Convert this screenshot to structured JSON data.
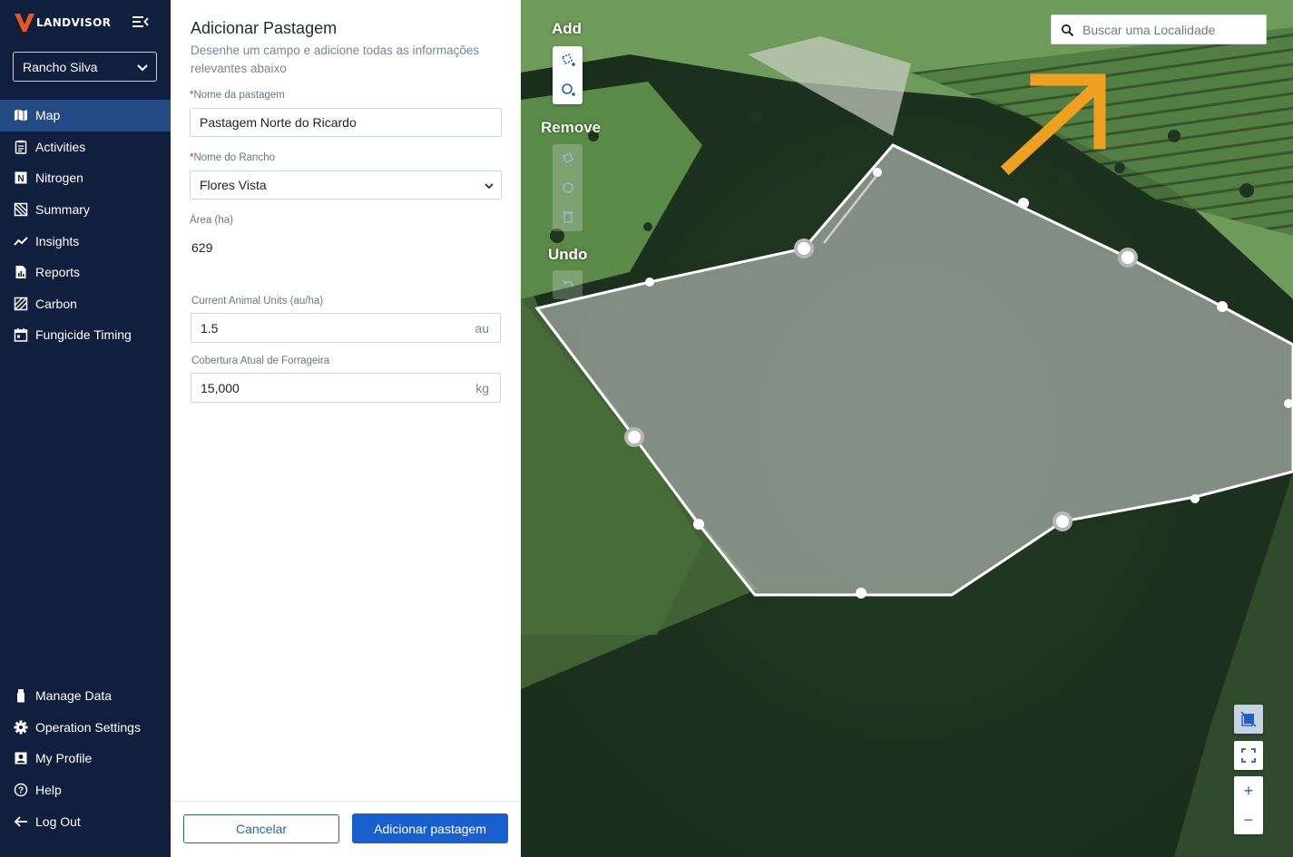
{
  "brand": {
    "name": "LANDVISOR"
  },
  "ranch_selector": {
    "value": "Rancho Silva"
  },
  "nav": {
    "top": [
      {
        "label": "Map",
        "icon": "map-icon",
        "active": true
      },
      {
        "label": "Activities",
        "icon": "clipboard-icon"
      },
      {
        "label": "Nitrogen",
        "icon": "nitrogen-icon"
      },
      {
        "label": "Summary",
        "icon": "summary-icon"
      },
      {
        "label": "Insights",
        "icon": "insights-icon"
      },
      {
        "label": "Reports",
        "icon": "reports-icon"
      },
      {
        "label": "Carbon",
        "icon": "carbon-icon"
      },
      {
        "label": "Fungicide Timing",
        "icon": "calendar-icon"
      }
    ],
    "bottom": [
      {
        "label": "Manage Data",
        "icon": "usb-drive-icon"
      },
      {
        "label": "Operation Settings",
        "icon": "gear-icon"
      },
      {
        "label": "My Profile",
        "icon": "profile-icon"
      },
      {
        "label": "Help",
        "icon": "help-icon"
      },
      {
        "label": "Log Out",
        "icon": "arrow-left-icon"
      }
    ]
  },
  "form": {
    "title": "Adicionar Pastagem",
    "subtitle": "Desenhe um campo e adicione todas as informações relevantes abaixo",
    "pasture_name": {
      "label": "Nome da pastagem",
      "required": true,
      "value": "Pastagem Norte do Ricardo"
    },
    "ranch_name": {
      "label": "Nome do Rancho",
      "required": true,
      "value": "Flores Vista"
    },
    "area": {
      "label": "Área (ha)",
      "value": "629"
    },
    "animal_units": {
      "label": "Current Animal Units (au/ha)",
      "value": "1.5",
      "unit": "au"
    },
    "forage_cover": {
      "label": "Cobertura Atual de Forrageira",
      "value": "15,000",
      "unit": "kg"
    },
    "cancel_label": "Cancelar",
    "submit_label": "Adicionar pastagem"
  },
  "map": {
    "draw_tools": {
      "add_label": "Add",
      "remove_label": "Remove",
      "undo_label": "Undo"
    },
    "search": {
      "placeholder": "Buscar uma Localidade"
    },
    "controls": {
      "zoom_in": "+",
      "zoom_out": "−"
    },
    "colors": {
      "accent": "#1a5fd0",
      "annotation_arrow": "#f0a020",
      "polygon_stroke": "#ffffff"
    }
  }
}
